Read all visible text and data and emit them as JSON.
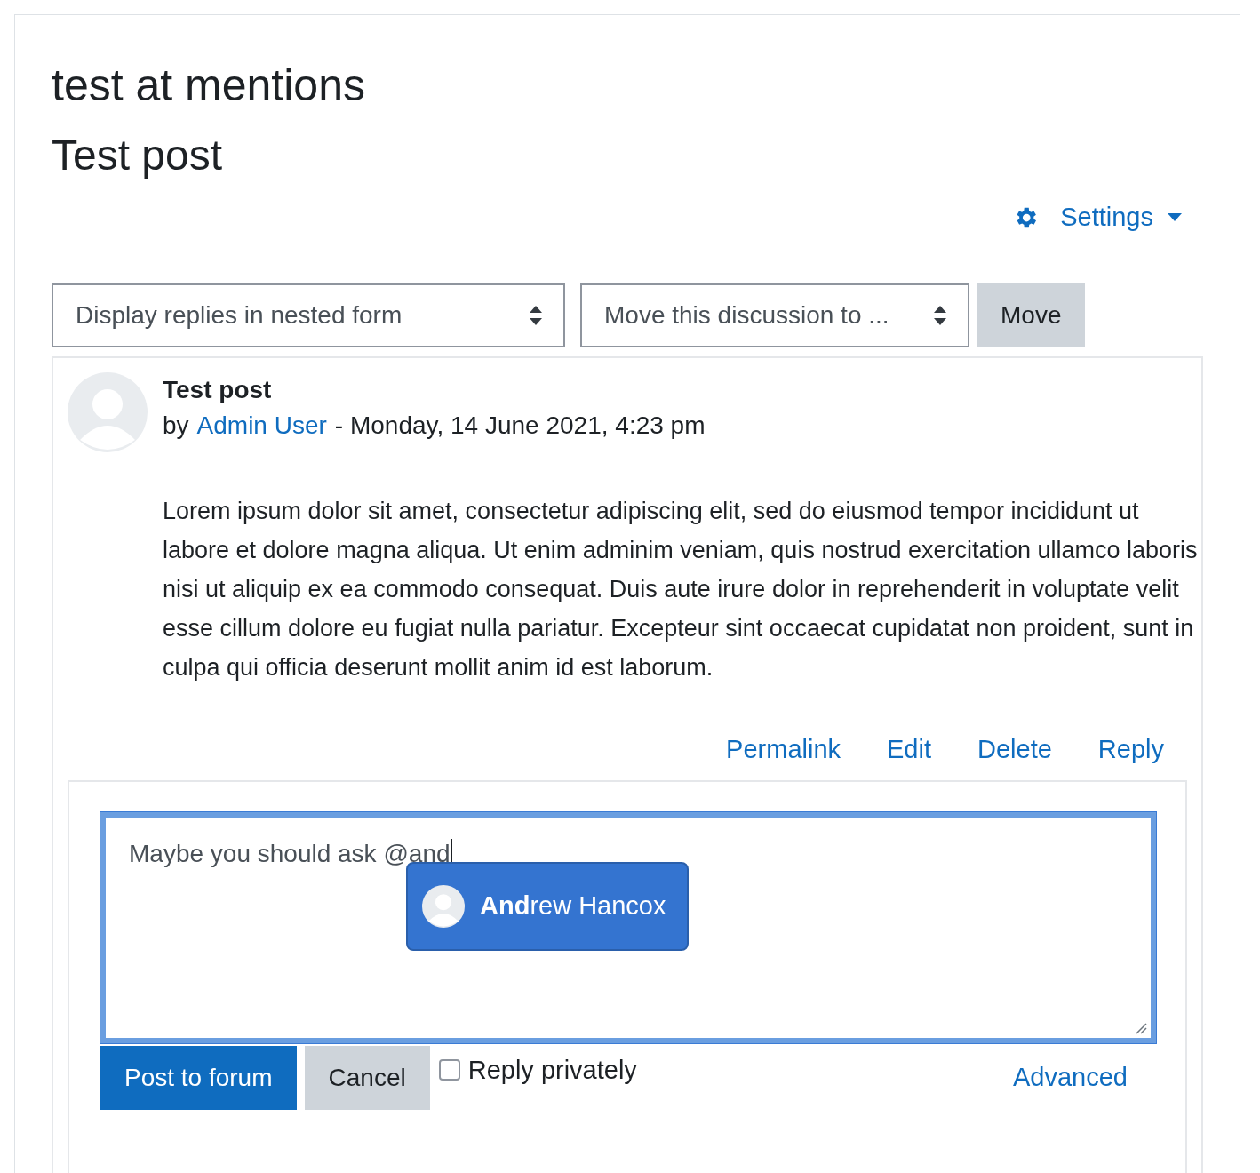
{
  "page": {
    "title": "test at mentions",
    "subtitle": "Test post"
  },
  "settings_menu": {
    "label": "Settings"
  },
  "controls": {
    "display_select": {
      "value": "Display replies in nested form"
    },
    "move_select": {
      "value": "Move this discussion to ..."
    },
    "move_button": "Move"
  },
  "post": {
    "title": "Test post",
    "byline_prefix": "by",
    "author": "Admin User",
    "date": "- Monday, 14 June 2021, 4:23 pm",
    "body": "Lorem ipsum dolor sit amet, consectetur adipiscing elit, sed do eiusmod tempor incididunt ut labore et dolore magna aliqua. Ut enim adminim veniam, quis nostrud exercitation ullamco laboris nisi ut aliquip ex ea commodo consequat. Duis aute irure dolor in reprehenderit in voluptate velit esse cillum dolore eu fugiat nulla pariatur. Excepteur sint occaecat cupidatat non proident, sunt in culpa qui officia deserunt mollit anim id est laborum.",
    "actions": [
      "Permalink",
      "Edit",
      "Delete",
      "Reply"
    ]
  },
  "reply_form": {
    "value": "Maybe you should ask @and",
    "focused": true,
    "mention_suggestions": [
      {
        "label": "**And**rew Hancox",
        "selected": true
      }
    ],
    "submit": "Post to forum",
    "cancel": "Cancel",
    "private": {
      "label": "Reply privately",
      "checked": false
    },
    "advanced": "Advanced"
  }
}
